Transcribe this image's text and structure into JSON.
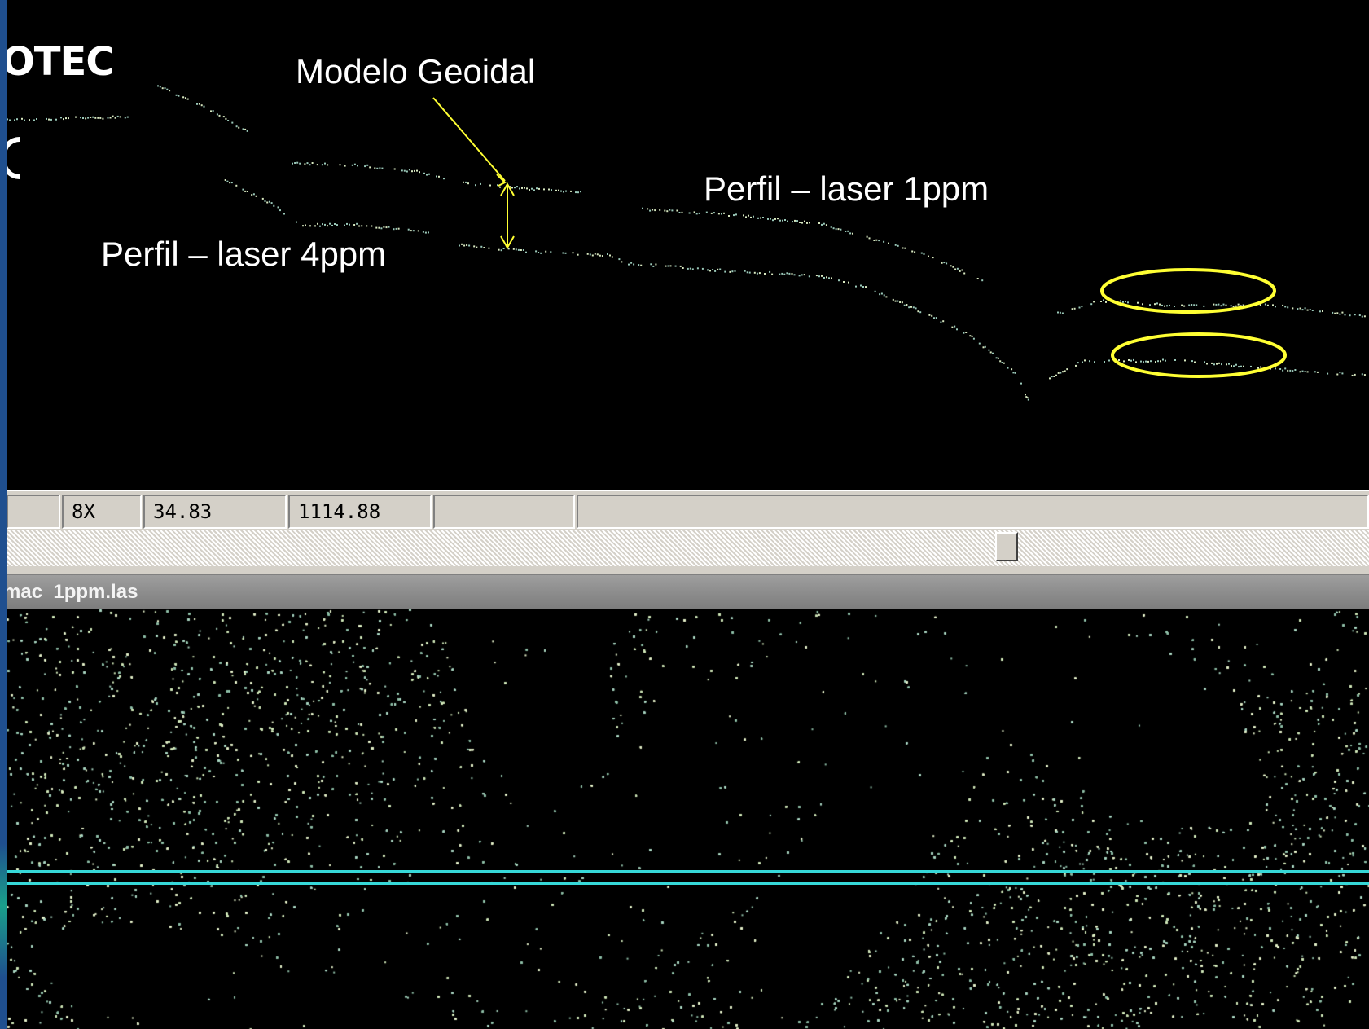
{
  "logo": {
    "text": "OTEC"
  },
  "annotations": {
    "geoid_model": "Modelo Geoidal",
    "profile_1ppm": "Perfil – laser 1ppm",
    "profile_4ppm": "Perfil – laser 4ppm"
  },
  "status_bar": {
    "zoom": "8X",
    "x_value": "34.83",
    "y_value": "1114.88"
  },
  "cloud_window": {
    "title": "mac_1ppm.las"
  },
  "colors": {
    "annotation": "#ffff33",
    "points": "#bfe8c8",
    "section_line": "#36d8d8",
    "panel": "#d4d0c8"
  },
  "icons": {
    "logo_mark": "c-shape"
  }
}
